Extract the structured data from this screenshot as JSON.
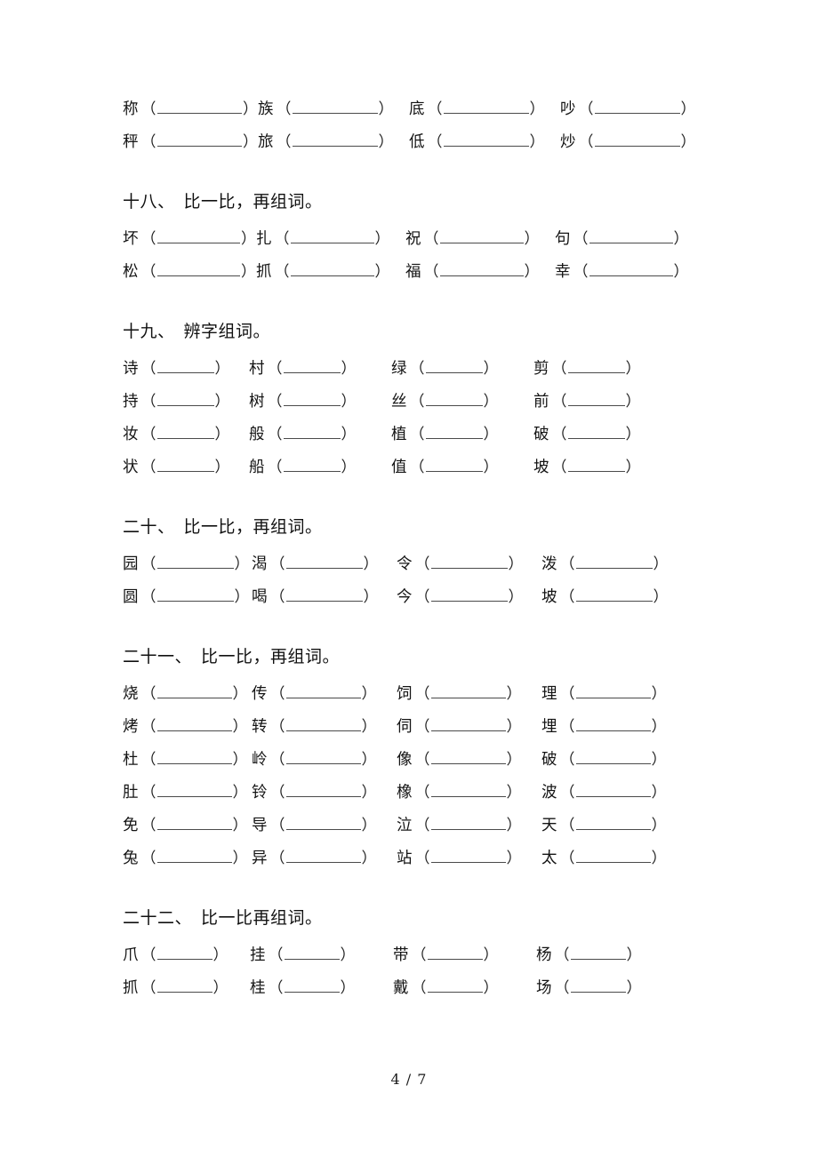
{
  "page": {
    "footer_label": "4 / 7"
  },
  "sections": [
    {
      "id": "section-continued",
      "number": "",
      "title": "",
      "has_heading": false,
      "blank_style": "w-wide",
      "rows": [
        [
          "称",
          "族",
          "底",
          "吵"
        ],
        [
          "秤",
          "旅",
          "低",
          "炒"
        ]
      ]
    },
    {
      "id": "section-18",
      "number": "十八、",
      "title": "比一比，再组词。",
      "has_heading": true,
      "blank_style": "w-wide2",
      "rows": [
        [
          "坏",
          "扎",
          "祝",
          "句"
        ],
        [
          "松",
          "抓",
          "福",
          "幸"
        ]
      ]
    },
    {
      "id": "section-19",
      "number": "十九、",
      "title": "辨字组词。",
      "has_heading": true,
      "blank_style": "w-narrow",
      "rows": [
        [
          "诗",
          "村",
          "绿",
          "剪"
        ],
        [
          "持",
          "树",
          "丝",
          "前"
        ],
        [
          "妆",
          "般",
          "植",
          "破"
        ],
        [
          "状",
          "船",
          "值",
          "坡"
        ]
      ]
    },
    {
      "id": "section-20",
      "number": "二十、",
      "title": "比一比，再组词。",
      "has_heading": true,
      "blank_style": "w-med",
      "rows": [
        [
          "园",
          "渴",
          "令",
          "泼"
        ],
        [
          "圆",
          "喝",
          "今",
          "坡"
        ]
      ]
    },
    {
      "id": "section-21",
      "number": "二十一、",
      "title": "比一比，再组词。",
      "has_heading": true,
      "blank_style": "w-med2",
      "rows": [
        [
          "烧",
          "传",
          "饲",
          "理"
        ],
        [
          "烤",
          "转",
          "伺",
          "埋"
        ],
        [
          "杜",
          "岭",
          "像",
          "破"
        ],
        [
          "肚",
          "铃",
          "橡",
          "波"
        ],
        [
          "免",
          "导",
          "泣",
          "天"
        ],
        [
          "兔",
          "异",
          "站",
          "太"
        ]
      ]
    },
    {
      "id": "section-22",
      "number": "二十二、",
      "title": "比一比再组词。",
      "has_heading": true,
      "blank_style": "w-narrow2",
      "rows": [
        [
          "爪",
          "挂",
          "带",
          "杨"
        ],
        [
          "抓",
          "桂",
          "戴",
          "场"
        ]
      ]
    }
  ]
}
